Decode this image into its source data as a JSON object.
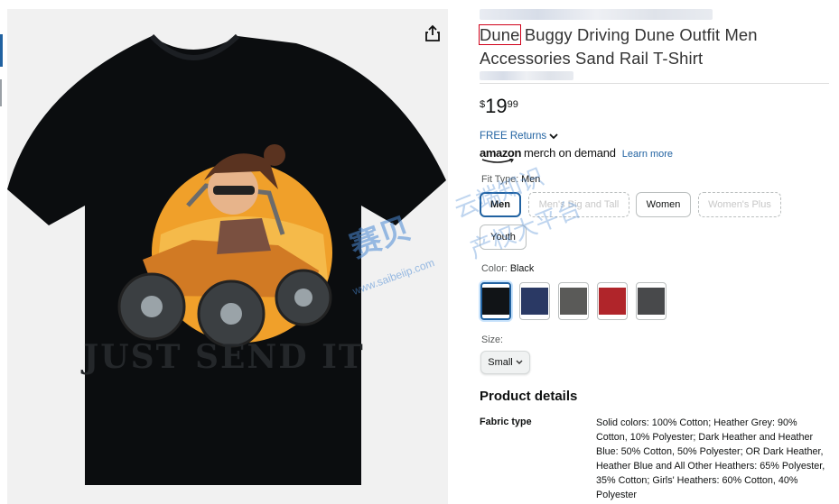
{
  "product": {
    "title_highlight": "Dune",
    "title_rest": " Buggy Driving Dune Outfit Men Accessories Sand Rail T-Shirt",
    "image_text": "JUST SEND IT",
    "shirt_color": "#0b0d0f"
  },
  "price": {
    "symbol": "$",
    "whole": "19",
    "fraction": "99"
  },
  "returns": {
    "label": "FREE Returns"
  },
  "merch": {
    "logo": "amazon",
    "logo_sub": "merch on demand",
    "learn_more": "Learn more"
  },
  "fit": {
    "label": "Fit Type:",
    "selected": "Men",
    "options": [
      "Men",
      "Men's Big and Tall",
      "Women",
      "Women's Plus",
      "Youth"
    ]
  },
  "color": {
    "label": "Color:",
    "selected": "Black",
    "swatches": [
      "#111417",
      "#2a3964",
      "#5a5a58",
      "#b0252a",
      "#48494b"
    ]
  },
  "size": {
    "label": "Size:",
    "selected": "Small"
  },
  "details": {
    "heading": "Product details",
    "fabric_key": "Fabric type",
    "fabric_value": "Solid colors: 100% Cotton; Heather Grey: 90% Cotton, 10% Polyester; Dark Heather and Heather Blue: 50% Cotton, 50% Polyester; OR Dark Heather, Heather Blue and All Other Heathers: 65% Polyester, 35% Cotton; Girls' Heathers: 60% Cotton, 40% Polyester"
  },
  "watermark": {
    "cn_main": "赛贝",
    "cn_right_1": "云端知识",
    "cn_right_2": "产权大平台",
    "url": "www.saibeiip.com"
  },
  "icons": {
    "share": "share-icon",
    "chevron": "chevron-down-icon"
  }
}
